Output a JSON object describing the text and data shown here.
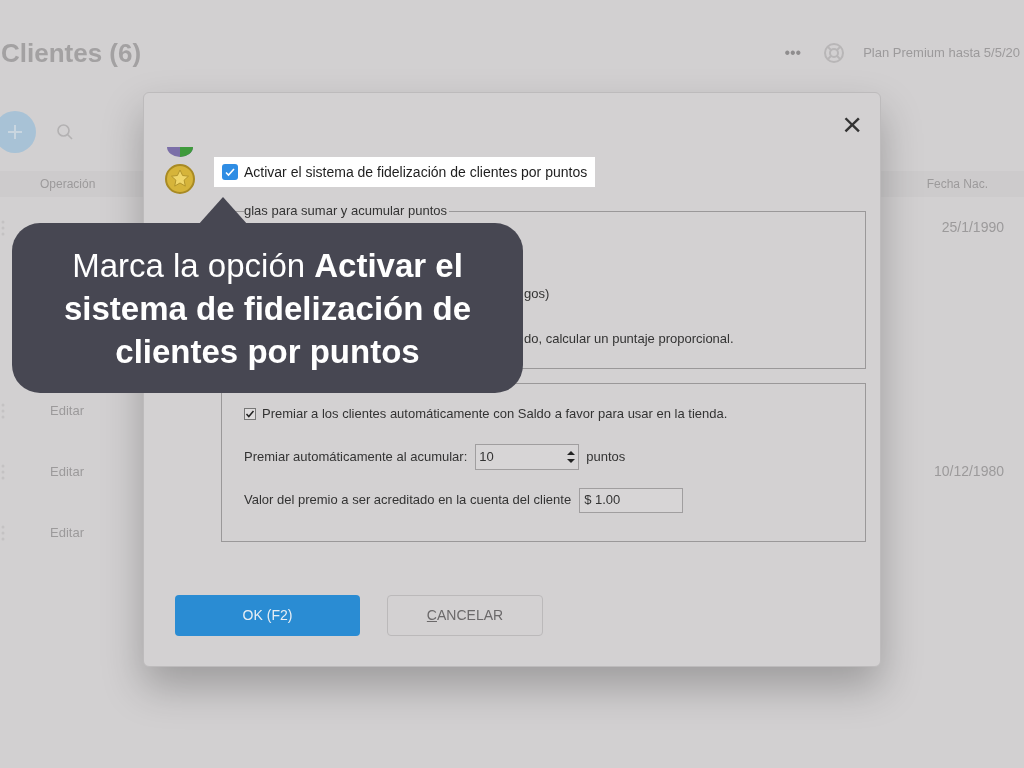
{
  "page": {
    "title": "Clientes (6)",
    "plan": "Plan Premium hasta 5/5/20",
    "more": "•••",
    "columns": [
      "Operación",
      "Fecha Nac."
    ],
    "rows": [
      {
        "date": "25/1/1990"
      },
      {
        "op": "Editar"
      },
      {
        "op": "Editar",
        "date": "10/12/1980"
      },
      {
        "op": "Editar"
      }
    ]
  },
  "dialog": {
    "close": "×",
    "enable": {
      "label": "Activar el sistema de fidelización de clientes por puntos",
      "checked": true
    },
    "rules": {
      "legend": "glas para sumar y acumular puntos",
      "lines": [
        "gos)",
        "do, calcular un puntaje proporcional."
      ]
    },
    "reward": {
      "auto": {
        "label": "Premiar a los clientes automáticamente con Saldo a favor para usar en la tienda.",
        "checked": true
      },
      "threshold": {
        "label": "Premiar automáticamente al acumular:",
        "value": "10",
        "unit": "puntos"
      },
      "amount": {
        "label": "Valor del premio a ser acreditado en la cuenta del cliente",
        "value": "$ 1.00"
      }
    },
    "buttons": [
      {
        "label": "OK (F2)",
        "kind": "primary"
      },
      {
        "label": "CANCELAR",
        "kind": "secondary"
      }
    ]
  },
  "tooltip": {
    "text": "Marca la opción **Activar el sistema de fidelización de clientes por puntos**"
  }
}
